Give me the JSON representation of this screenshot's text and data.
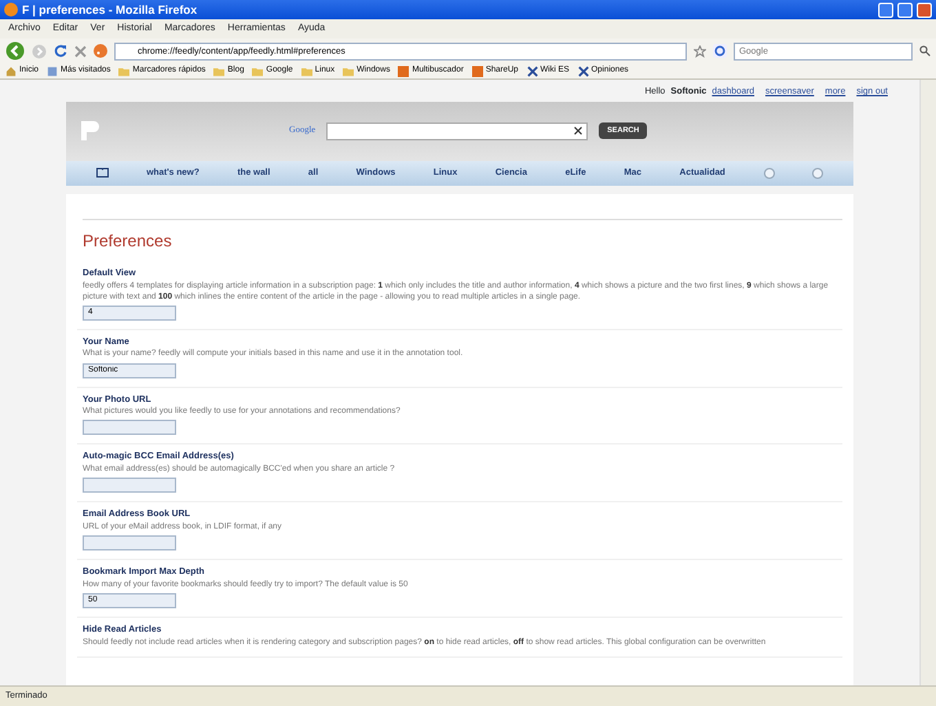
{
  "window": {
    "title": "F | preferences - Mozilla Firefox"
  },
  "menu": [
    "Archivo",
    "Editar",
    "Ver",
    "Historial",
    "Marcadores",
    "Herramientas",
    "Ayuda"
  ],
  "address_bar": {
    "value": "chrome://feedly/content/app/feedly.html#preferences"
  },
  "search_bar": {
    "placeholder": "Google"
  },
  "bookmarks": [
    {
      "label": "Inicio",
      "kind": "home"
    },
    {
      "label": "Más visitados",
      "kind": "page"
    },
    {
      "label": "Marcadores rápidos",
      "kind": "folder"
    },
    {
      "label": "Blog",
      "kind": "folder"
    },
    {
      "label": "Google",
      "kind": "folder"
    },
    {
      "label": "Linux",
      "kind": "folder"
    },
    {
      "label": "Windows",
      "kind": "folder"
    },
    {
      "label": "Multibuscador",
      "kind": "site"
    },
    {
      "label": "ShareUp",
      "kind": "site"
    },
    {
      "label": "Wiki ES",
      "kind": "x"
    },
    {
      "label": "Opiniones",
      "kind": "x"
    }
  ],
  "user_bar": {
    "greeting": "Hello",
    "user": "Softonic",
    "links": [
      "dashboard",
      "screensaver",
      "more",
      "sign out"
    ]
  },
  "header": {
    "search_brand": "Google",
    "search_button": "SEARCH"
  },
  "tabs": [
    "what's new?",
    "the wall",
    "all",
    "Windows",
    "Linux",
    "Ciencia",
    "eLife",
    "Mac",
    "Actualidad"
  ],
  "page": {
    "title": "Preferences",
    "sections": [
      {
        "label": "Default View",
        "description": "feedly offers 4 templates for displaying article information in a subscription page: **1** which only includes the title and author information, **4** which shows a picture and the two first lines, **9** which shows a large picture with text and **100** which inlines the entire content of the article in the page - allowing you to read multiple articles in a single page.",
        "kind": "input",
        "value": "4"
      },
      {
        "label": "Your Name",
        "description": "What is your name? feedly will compute your initials based in this name and use it in the annotation tool.",
        "kind": "input",
        "value": "Softonic"
      },
      {
        "label": "Your Photo URL",
        "description": "What pictures would you like feedly to use for your annotations and recommendations?",
        "kind": "input"
      },
      {
        "label": "Auto-magic BCC Email Address(es)",
        "description": "What email address(es) should be automagically BCC'ed when you share an article ?",
        "kind": "input"
      },
      {
        "label": "Email Address Book URL",
        "description": "URL of your eMail address book, in LDIF format, if any",
        "kind": "input"
      },
      {
        "label": "Bookmark Import Max Depth",
        "description": "How many of your favorite bookmarks should feedly try to import? The default value is 50",
        "kind": "input",
        "value": "50"
      },
      {
        "label": "Hide Read Articles",
        "description": "Should feedly not include read articles when it is rendering category and subscription pages? **on** to hide read articles, **off** to show read articles. This global configuration can be overwritten",
        "kind": "text"
      }
    ]
  },
  "status_bar": {
    "text": "Terminado"
  }
}
